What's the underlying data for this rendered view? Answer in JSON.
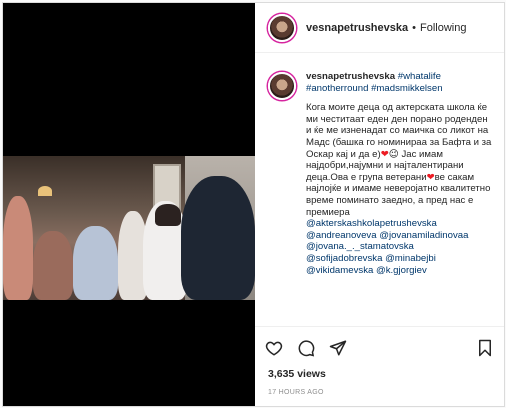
{
  "post": {
    "username": "vesnapetrushevska",
    "separator": "•",
    "follow_status": "Following",
    "caption_user": "vesnapetrushevska",
    "hashtags": "#whatalife #anotherround #madsmikkelsen",
    "body_1": "Кога моите деца од актерската школа ќе ми честитаат еден ден порано роденден и ќе ме изненадат со маичка со ликот на Мадс (башка го номинираа за Бафта и за Оскар кај и да е)",
    "body_2": "Јас имам најдобри,најумни и најталентирани деца.Ова е група ветерани",
    "body_3": "ве сакам најлојќе и имаме неверојатно квалитетно време поминато заедно, а пред нас е премиера",
    "mentions": [
      "@akterskashkolapetrushevska",
      "@andreanoveva @jovanamiladinovaa",
      "@jovana._._stamatovska",
      "@sofijadobrevska @minabejbi",
      "@vikidamevska @k.gjorgiev"
    ],
    "views": "3,635 views",
    "posted": "17 HOURS AGO"
  },
  "icons": [
    "heart-icon",
    "comment-icon",
    "share-icon",
    "bookmark-icon"
  ],
  "colors": {
    "link": "#00376b",
    "heart": "#ed1c24",
    "muted": "#8e8e8e"
  }
}
